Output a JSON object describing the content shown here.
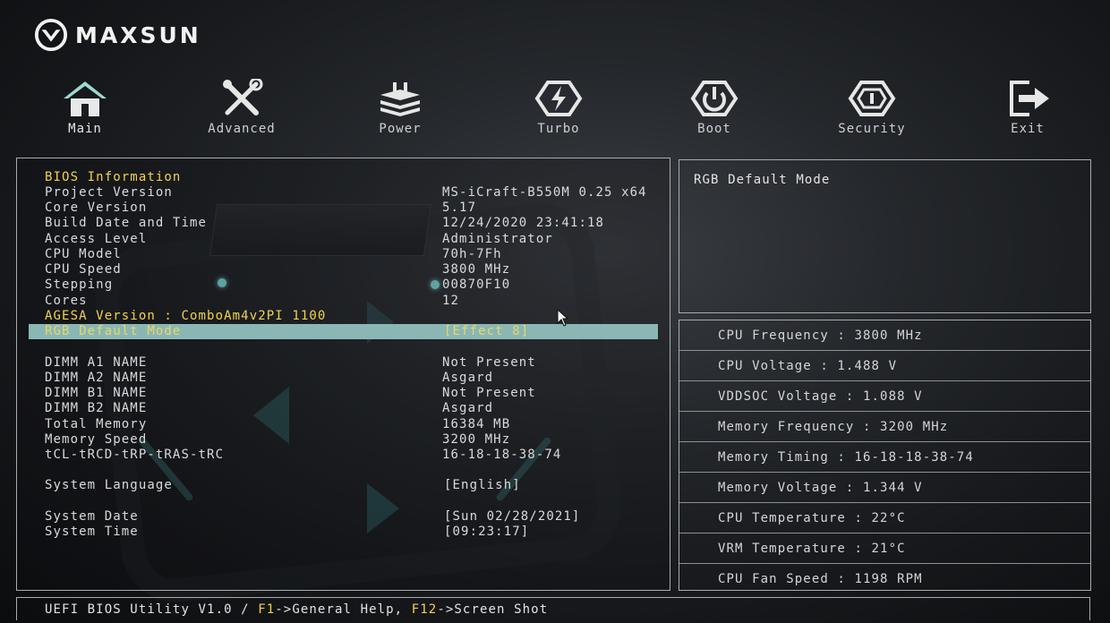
{
  "brand": {
    "name": "MAXSUN",
    "logo_icon": "maxsun-logo-icon"
  },
  "nav": [
    {
      "label": "Main",
      "icon": "home-icon"
    },
    {
      "label": "Advanced",
      "icon": "tools-icon"
    },
    {
      "label": "Power",
      "icon": "power-chip-icon"
    },
    {
      "label": "Turbo",
      "icon": "turbo-bolt-icon"
    },
    {
      "label": "Boot",
      "icon": "power-button-icon"
    },
    {
      "label": "Security",
      "icon": "shield-icon"
    },
    {
      "label": "Exit",
      "icon": "exit-icon"
    }
  ],
  "main": {
    "section_title": "BIOS Information",
    "rows": [
      {
        "label": "Project Version",
        "value": "MS-iCraft-B550M 0.25 x64"
      },
      {
        "label": "Core Version",
        "value": "5.17"
      },
      {
        "label": "Build Date and Time",
        "value": "12/24/2020 23:41:18"
      },
      {
        "label": "Access Level",
        "value": "Administrator"
      },
      {
        "label": "CPU Model",
        "value": "70h-7Fh"
      },
      {
        "label": "CPU Speed",
        "value": "3800 MHz"
      },
      {
        "label": "Stepping",
        "value": "00870F10"
      },
      {
        "label": "Cores",
        "value": "12"
      }
    ],
    "agesa": "AGESA Version : ComboAm4v2PI 1100",
    "rgb_mode": {
      "label": "RGB Default Mode",
      "value": "[Effect 8]"
    },
    "memory_rows": [
      {
        "label": "DIMM A1 NAME",
        "value": "Not Present"
      },
      {
        "label": "DIMM A2 NAME",
        "value": "Asgard"
      },
      {
        "label": "DIMM B1 NAME",
        "value": "Not Present"
      },
      {
        "label": "DIMM B2 NAME",
        "value": "Asgard"
      },
      {
        "label": "Total Memory",
        "value": "16384 MB"
      },
      {
        "label": "Memory Speed",
        "value": "3200 MHz"
      },
      {
        "label": "tCL-tRCD-tRP-tRAS-tRC",
        "value": "16-18-18-38-74"
      }
    ],
    "language": {
      "label": "System Language",
      "value": "[English]"
    },
    "date": {
      "label": "System Date",
      "value": "[Sun 02/28/2021]"
    },
    "time": {
      "label": "System Time",
      "value": "[09:23:17]"
    }
  },
  "help": {
    "text": "RGB Default Mode"
  },
  "stats": [
    "CPU Frequency : 3800 MHz",
    "CPU Voltage : 1.488 V",
    "VDDSOC Voltage : 1.088 V",
    "Memory Frequency : 3200 MHz",
    "Memory Timing : 16-18-18-38-74",
    "Memory Voltage : 1.344 V",
    "CPU Temperature : 22°C",
    "VRM Temperature : 21°C",
    "CPU Fan Speed : 1198 RPM"
  ],
  "footer": {
    "prefix": "UEFI BIOS Utility V1.0 / ",
    "key1": "F1",
    "text1": "->General Help, ",
    "key2": "F12",
    "text2": "->Screen Shot"
  },
  "colors": {
    "highlight_bar": "#8ab7b4",
    "yellow_text": "#f2d24a",
    "border": "#a9acae"
  }
}
